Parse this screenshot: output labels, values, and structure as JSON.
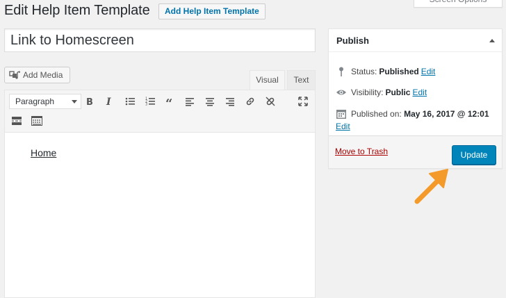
{
  "header": {
    "page_title": "Edit Help Item Template",
    "add_new_label": "Add Help Item Template",
    "screen_options_label": "Screen Options"
  },
  "post": {
    "title": "Link to Homescreen",
    "content_link_text": "Home"
  },
  "editor": {
    "add_media_label": "Add Media",
    "tabs": {
      "visual": "Visual",
      "text": "Text"
    },
    "format_select_value": "Paragraph",
    "toolbar_icons": [
      "bold-icon",
      "italic-icon",
      "bulleted-list-icon",
      "numbered-list-icon",
      "blockquote-icon",
      "align-left-icon",
      "align-center-icon",
      "align-right-icon",
      "insert-link-icon",
      "remove-link-icon",
      "fullscreen-icon",
      "read-more-icon",
      "toolbar-toggle-icon"
    ]
  },
  "publish": {
    "title": "Publish",
    "status_label": "Status:",
    "status_value": "Published",
    "visibility_label": "Visibility:",
    "visibility_value": "Public",
    "published_on_label": "Published on:",
    "published_on_value": "May 16, 2017 @ 12:01",
    "edit_label": "Edit",
    "trash_label": "Move to Trash",
    "update_label": "Update"
  },
  "colors": {
    "accent_blue": "#0085ba",
    "link_blue": "#0073aa",
    "trash_red": "#aa0000",
    "annotation_orange": "#f39a2a",
    "background": "#f1f1f1"
  }
}
